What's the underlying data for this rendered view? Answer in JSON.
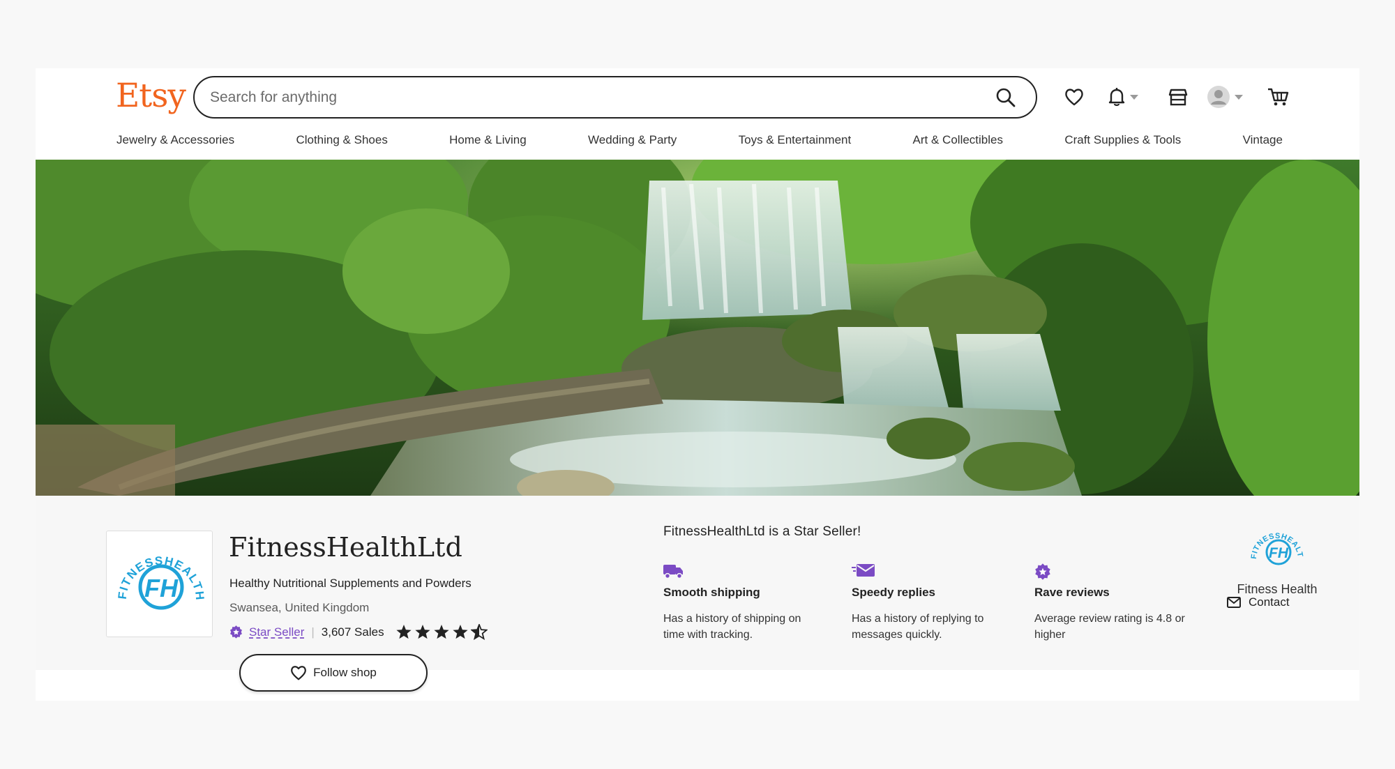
{
  "header": {
    "logo": "Etsy",
    "search_placeholder": "Search for anything",
    "icons": [
      "search-icon",
      "heart-icon",
      "bell-icon",
      "shop-icon",
      "avatar-icon",
      "cart-icon"
    ]
  },
  "categories": [
    "Jewelry & Accessories",
    "Clothing & Shoes",
    "Home & Living",
    "Wedding & Party",
    "Toys & Entertainment",
    "Art & Collectibles",
    "Craft Supplies & Tools",
    "Vintage"
  ],
  "shop": {
    "name": "FitnessHealthLtd",
    "tagline": "Healthy Nutritional Supplements and Powders",
    "location": "Swansea, United Kingdom",
    "star_seller_label": "Star Seller",
    "sales": "3,607 Sales",
    "rating_stars": 4.5,
    "follow_label": "Follow shop",
    "logo_text_arc": "FITNESSHEALTH.CO",
    "logo_monogram": "FH"
  },
  "star_seller": {
    "title": "FitnessHealthLtd is a Star Seller!",
    "features": [
      {
        "icon": "truck-icon",
        "title": "Smooth shipping",
        "desc": "Has a history of shipping on time with tracking."
      },
      {
        "icon": "message-icon",
        "title": "Speedy replies",
        "desc": "Has a history of replying to messages quickly."
      },
      {
        "icon": "star-badge-icon",
        "title": "Rave reviews",
        "desc": "Average review rating is 4.8 or higher"
      }
    ]
  },
  "owner": {
    "name": "Fitness Health",
    "contact_label": "Contact"
  },
  "colors": {
    "brand_orange": "#f1641e",
    "star_seller_purple": "#7b4bc4",
    "logo_blue": "#1fa2d8"
  }
}
